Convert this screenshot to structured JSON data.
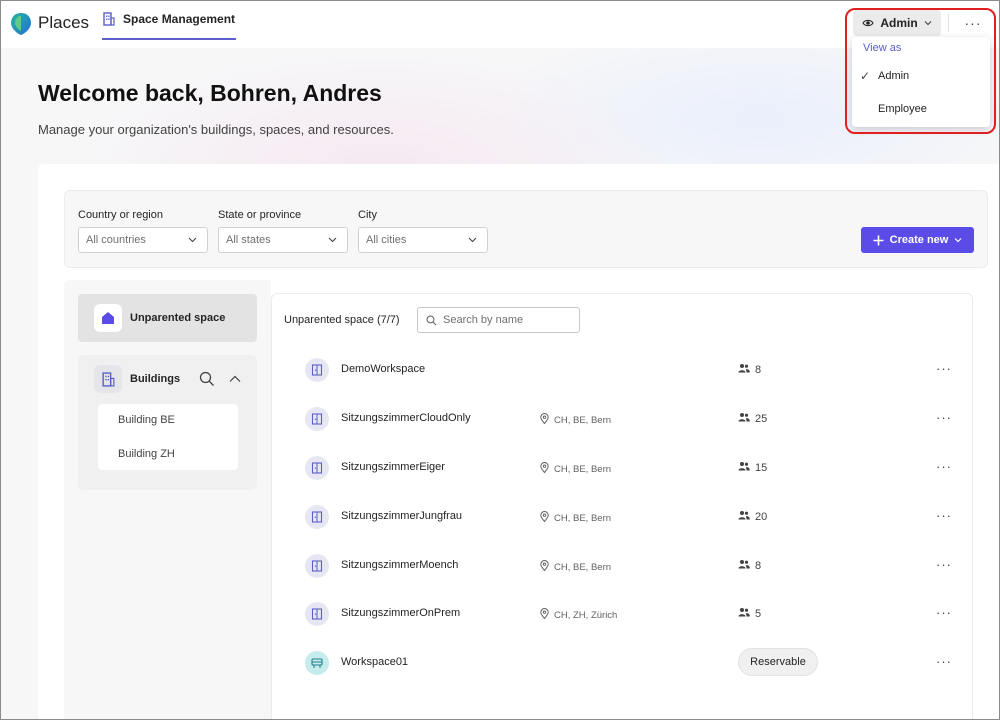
{
  "app": {
    "name": "Places"
  },
  "nav": {
    "active_tab": "Space Management"
  },
  "view_switcher": {
    "label": "Admin",
    "more_label": "···"
  },
  "view_menu": {
    "header": "View as",
    "options": [
      {
        "label": "Admin",
        "checked": true
      },
      {
        "label": "Employee",
        "checked": false
      }
    ]
  },
  "hero": {
    "title": "Welcome back, Bohren, Andres",
    "subtitle": "Manage your organization's buildings, spaces, and resources."
  },
  "filters": [
    {
      "label": "Country or region",
      "value": "All countries"
    },
    {
      "label": "State or province",
      "value": "All states"
    },
    {
      "label": "City",
      "value": "All cities"
    }
  ],
  "create_button": {
    "label": "Create new"
  },
  "sidebar": {
    "unparented_label": "Unparented space",
    "buildings_label": "Buildings",
    "buildings": [
      "Building BE",
      "Building ZH"
    ]
  },
  "list": {
    "title": "Unparented space (7/7)",
    "search_placeholder": "Search by name",
    "rows": [
      {
        "name": "DemoWorkspace",
        "location": "",
        "capacity": "8",
        "kind": "room"
      },
      {
        "name": "SitzungszimmerCloudOnly",
        "location": "CH, BE, Bern",
        "capacity": "25",
        "kind": "room"
      },
      {
        "name": "SitzungszimmerEiger",
        "location": "CH, BE, Bern",
        "capacity": "15",
        "kind": "room"
      },
      {
        "name": "SitzungszimmerJungfrau",
        "location": "CH, BE, Bern",
        "capacity": "20",
        "kind": "room"
      },
      {
        "name": "SitzungszimmerMoench",
        "location": "CH, BE, Bern",
        "capacity": "8",
        "kind": "room"
      },
      {
        "name": "SitzungszimmerOnPrem",
        "location": "CH, ZH, Zürich",
        "capacity": "5",
        "kind": "room"
      },
      {
        "name": "Workspace01",
        "location": "",
        "capacity": "",
        "badge": "Reservable",
        "kind": "workspace"
      }
    ],
    "row_more_label": "···"
  },
  "colors": {
    "accent": "#5b4ce8",
    "highlight": "#e02020",
    "nav_underline": "#5b5fc7"
  }
}
